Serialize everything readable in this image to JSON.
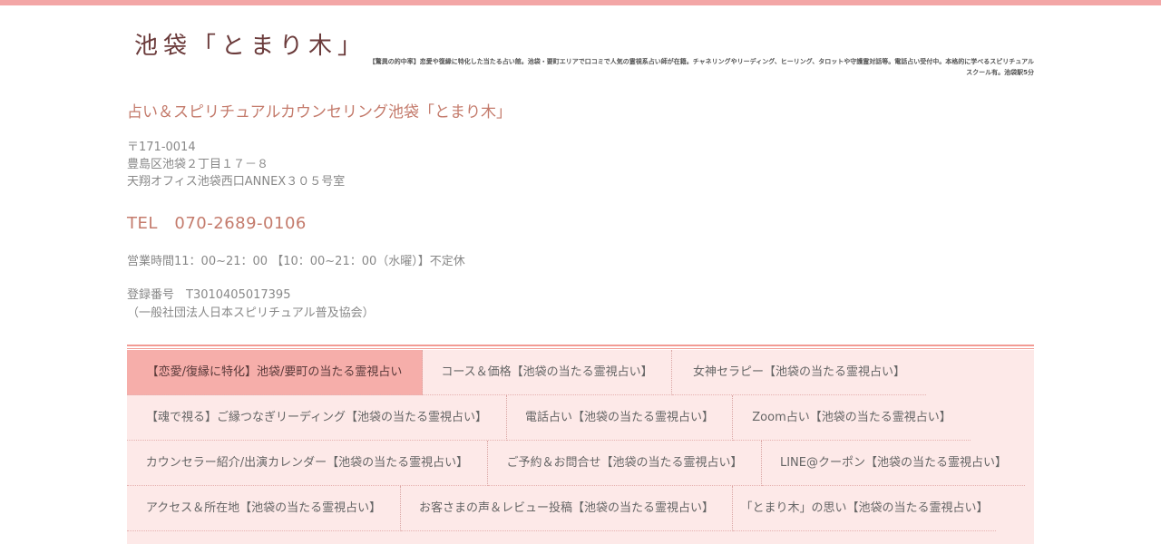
{
  "header": {
    "logo": "池袋「とまり木」",
    "tagline": "【驚異の的中率】恋愛や復縁に特化した当たる占い館。池袋・要町エリアで口コミで人気の霊視系占い師が在籍。チャネリングやリーディング、ヒーリング、タロットや守護霊対話等。電話占い受付中。本格的に学べるスピリチュアルスクール有。池袋駅5分"
  },
  "info": {
    "title": "占い＆スピリチュアルカウンセリング池袋「とまり木」",
    "postal": "〒171-0014",
    "address1": "豊島区池袋２丁目１７－８",
    "address2": "天翔オフィス池袋西口ANNEX３０５号室",
    "tel": "TEL　070-2689-0106",
    "hours": "営業時間11：00~21：00 【10：00~21：00（水曜）】不定休",
    "registration": "登録番号　T3010405017395",
    "association": "（一般社団法人日本スピリチュアル普及協会）"
  },
  "nav": {
    "items": [
      "【恋愛/復縁に特化】池袋/要町の当たる霊視占い",
      "コース＆価格【池袋の当たる霊視占い】",
      "女神セラピー【池袋の当たる霊視占い】",
      "【魂で視る】ご縁つなぎリーディング【池袋の当たる霊視占い】",
      "電話占い【池袋の当たる霊視占い】",
      "Zoom占い【池袋の当たる霊視占い】",
      "カウンセラー紹介/出演カレンダー【池袋の当たる霊視占い】",
      "ご予約＆お問合せ【池袋の当たる霊視占い】",
      "LINE@クーポン【池袋の当たる霊視占い】",
      "アクセス＆所在地【池袋の当たる霊視占い】",
      "お客さまの声＆レビュー投稿【池袋の当たる霊視占い】",
      "「とまり木」の思い【池袋の当たる霊視占い】"
    ]
  },
  "colors": {
    "accent": "#f3a6a6",
    "title": "#c47b6c",
    "nav_bg": "#fde9e8",
    "nav_active": "#f6aeaa"
  }
}
